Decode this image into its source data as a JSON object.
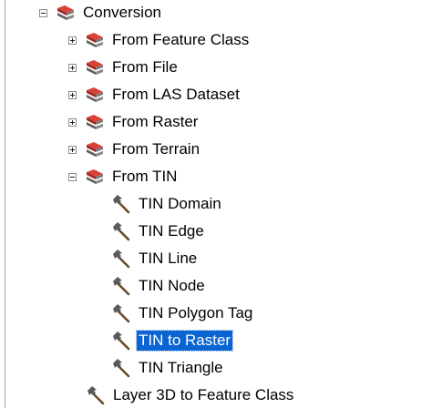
{
  "tree": {
    "root": {
      "label": "Conversion",
      "expanded": true,
      "icon": "toolbox-icon"
    },
    "groups": [
      {
        "label": "From Feature Class",
        "expanded": false,
        "icon": "toolset-icon"
      },
      {
        "label": "From File",
        "expanded": false,
        "icon": "toolset-icon"
      },
      {
        "label": "From LAS Dataset",
        "expanded": false,
        "icon": "toolset-icon"
      },
      {
        "label": "From Raster",
        "expanded": false,
        "icon": "toolset-icon"
      },
      {
        "label": "From Terrain",
        "expanded": false,
        "icon": "toolset-icon"
      },
      {
        "label": "From TIN",
        "expanded": true,
        "icon": "toolset-icon"
      }
    ],
    "tin_tools": [
      {
        "label": "TIN Domain",
        "icon": "hammer-icon"
      },
      {
        "label": "TIN Edge",
        "icon": "hammer-icon"
      },
      {
        "label": "TIN Line",
        "icon": "hammer-icon"
      },
      {
        "label": "TIN Node",
        "icon": "hammer-icon"
      },
      {
        "label": "TIN Polygon Tag",
        "icon": "hammer-icon"
      },
      {
        "label": "TIN to Raster",
        "icon": "hammer-icon",
        "selected": true
      },
      {
        "label": "TIN Triangle",
        "icon": "hammer-icon"
      }
    ],
    "bottom_tool": {
      "label": "Layer 3D to Feature Class",
      "icon": "hammer-icon"
    }
  },
  "colors": {
    "selection": "#0a64d2",
    "toolset_red": "#c8312b",
    "toolset_gray": "#6e6e6e"
  }
}
